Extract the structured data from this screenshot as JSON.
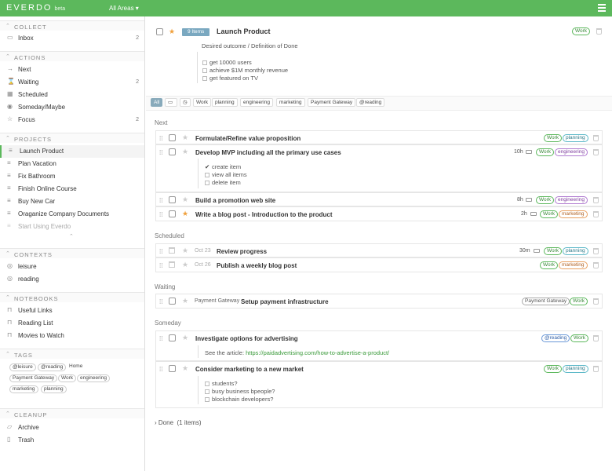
{
  "app": {
    "logo": "EVERDO",
    "beta": "beta",
    "areas": "All Areas ▾"
  },
  "sidebar": {
    "collect": {
      "label": "COLLECT",
      "items": [
        {
          "label": "Inbox",
          "count": "2"
        }
      ]
    },
    "actions": {
      "label": "ACTIONS",
      "items": [
        {
          "label": "Next",
          "count": ""
        },
        {
          "label": "Waiting",
          "count": "2"
        },
        {
          "label": "Scheduled",
          "count": ""
        },
        {
          "label": "Someday/Maybe",
          "count": ""
        },
        {
          "label": "Focus",
          "count": "2"
        }
      ]
    },
    "projects": {
      "label": "PROJECTS",
      "items": [
        {
          "label": "Launch Product"
        },
        {
          "label": "Plan Vacation"
        },
        {
          "label": "Fix Bathroom"
        },
        {
          "label": "Finish Online Course"
        },
        {
          "label": "Buy New Car"
        },
        {
          "label": "Oraganize Company Documents"
        },
        {
          "label": "Start Using Everdo"
        }
      ]
    },
    "contexts": {
      "label": "CONTEXTS",
      "items": [
        {
          "label": "leisure"
        },
        {
          "label": "reading"
        }
      ]
    },
    "notebooks": {
      "label": "NOTEBOOKS",
      "items": [
        {
          "label": "Useful Links"
        },
        {
          "label": "Reading List"
        },
        {
          "label": "Movies to Watch"
        }
      ]
    },
    "tags": {
      "label": "TAGS",
      "items": [
        "@leisure",
        "@reading",
        "Home",
        "Payment Gateway",
        "Work",
        "engineering",
        "marketing",
        "planning"
      ]
    },
    "cleanup": {
      "label": "CLEANUP",
      "items": [
        {
          "label": "Archive"
        },
        {
          "label": "Trash"
        }
      ]
    }
  },
  "project": {
    "items_badge": "9 Items",
    "title": "Launch Product",
    "tag": "Work",
    "outcome": "Desired outcome / Definition of Done",
    "checklist": [
      "get 10000 users",
      "achieve $1M monthly revenue",
      "get featured on TV"
    ]
  },
  "filters": [
    "All",
    "Work",
    "planning",
    "engineering",
    "marketing",
    "Payment Gateway",
    "@reading"
  ],
  "groups": {
    "next": "Next",
    "scheduled": "Scheduled",
    "waiting": "Waiting",
    "someday": "Someday",
    "done": "Done",
    "done_count": "(1 items)"
  },
  "tasks": {
    "t1": {
      "title": "Formulate/Refine value proposition",
      "tags": [
        "Work",
        "planning"
      ]
    },
    "t2": {
      "title": "Develop MVP including all the primary use cases",
      "time": "10h",
      "tags": [
        "Work",
        "engineering"
      ],
      "checklist": [
        "create item",
        "view all items",
        "delete item"
      ]
    },
    "t3": {
      "title": "Build a promotion web site",
      "time": "8h",
      "tags": [
        "Work",
        "engineering"
      ]
    },
    "t4": {
      "title": "Write a blog post - Introduction to the product",
      "time": "2h",
      "tags": [
        "Work",
        "marketing"
      ]
    },
    "t5": {
      "date": "Oct 23",
      "title": "Review progress",
      "time": "30m",
      "tags": [
        "Work",
        "planning"
      ]
    },
    "t6": {
      "date": "Oct 26",
      "title": "Publish a weekly blog post",
      "tags": [
        "Work",
        "marketing"
      ]
    },
    "t7": {
      "context": "Payment Gateway",
      "title": "Setup payment infrastructure",
      "tags": [
        "Payment Gateway",
        "Work"
      ]
    },
    "t8": {
      "title": "Investigate options for advertising",
      "tags": [
        "@reading",
        "Work"
      ],
      "note_prefix": "See the article: ",
      "note_link": "https://paidadvertising.com/how-to-advertise-a-product/"
    },
    "t9": {
      "title": "Consider marketing to a new market",
      "tags": [
        "Work",
        "planning"
      ],
      "checklist": [
        "students?",
        "busy business bpeople?",
        "blockchain developers?"
      ]
    }
  },
  "colors": {
    "accent": "#5cb85c",
    "star": "#f0a03c"
  }
}
